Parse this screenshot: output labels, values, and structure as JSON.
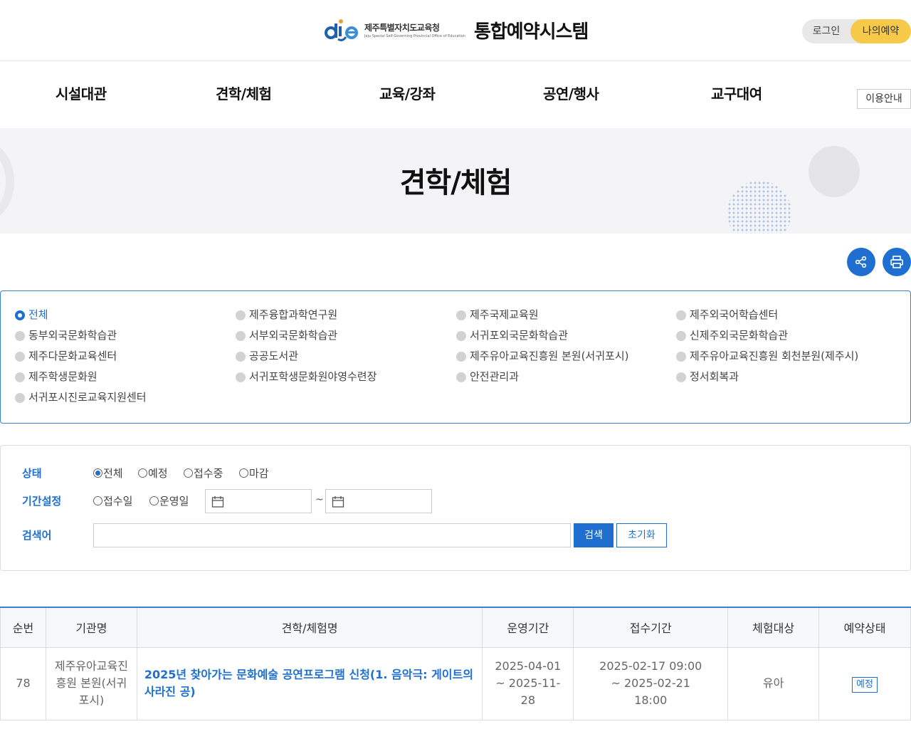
{
  "header": {
    "org_name": "제주특별자치도교육청",
    "org_english": "Jeju Special Self-Governing Provincial Office of Education",
    "system_title": "통합예약시스템",
    "login_label": "로그인",
    "my_reservation_label": "나의예약"
  },
  "nav": {
    "items": [
      "시설대관",
      "견학/체험",
      "교육/강좌",
      "공연/행사",
      "교구대여"
    ],
    "guide_label": "이용안내"
  },
  "hero": {
    "title": "견학/체험"
  },
  "organizations": {
    "selected": "전체",
    "items": [
      "전체",
      "제주융합과학연구원",
      "제주국제교육원",
      "제주외국어학습센터",
      "동부외국문화학습관",
      "서부외국문화학습관",
      "서귀포외국문화학습관",
      "신제주외국문화학습관",
      "제주다문화교육센터",
      "공공도서관",
      "제주유아교육진흥원 본원(서귀포시)",
      "제주유아교육진흥원 회천분원(제주시)",
      "제주학생문화원",
      "서귀포학생문화원야영수련장",
      "안전관리과",
      "정서회복과",
      "서귀포시진로교육지원센터"
    ]
  },
  "search": {
    "status_label": "상태",
    "status_options": [
      "전체",
      "예정",
      "접수중",
      "마감"
    ],
    "status_selected": "전체",
    "period_label": "기간설정",
    "period_options": [
      "접수일",
      "운영일"
    ],
    "date_separator": "~",
    "keyword_label": "검색어",
    "keyword_value": "",
    "search_button": "검색",
    "reset_button": "초기화"
  },
  "table": {
    "headers": [
      "순번",
      "기관명",
      "견학/체험명",
      "운영기간",
      "접수기간",
      "체험대상",
      "예약상태"
    ],
    "rows": [
      {
        "no": "78",
        "org": "제주유아교육진흥원 본원(서귀포시)",
        "name": "2025년 찾아가는 문화예술 공연프로그램 신청(1. 음악극: 게이트의 사라진 공)",
        "op_period": "2025-04-01 ~ 2025-11-28",
        "reg_period": "2025-02-17 09:00 ~ 2025-02-21 18:00",
        "target": "유아",
        "status": "예정"
      }
    ]
  },
  "colors": {
    "primary": "#1f6fd1",
    "accent_yellow": "#f7c948"
  },
  "icons": {
    "share": "share-icon",
    "print": "print-icon",
    "calendar": "calendar-icon"
  }
}
